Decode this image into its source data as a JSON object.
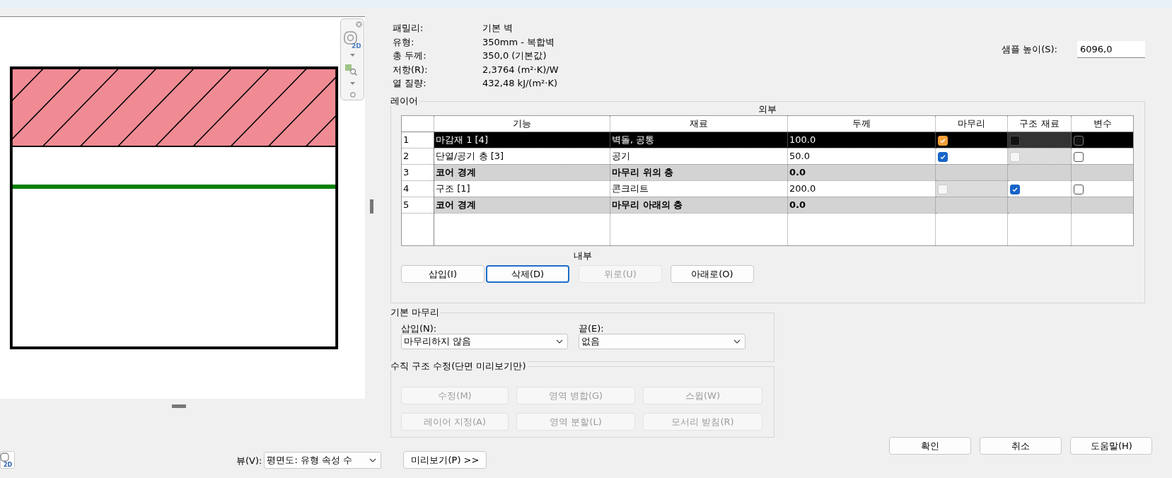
{
  "info": [
    {
      "label": "패밀리:",
      "value": "기본 벽"
    },
    {
      "label": "유형:",
      "value": "350mm - 복합벽"
    },
    {
      "label": "총 두께:",
      "value": "350,0 (기본값)"
    },
    {
      "label": "저항(R):",
      "value": "2,3764 (m²·K)/W"
    },
    {
      "label": "열 질량:",
      "value": "432,48 kJ/(m²·K)"
    }
  ],
  "sample_height": {
    "label": "샘플 높이(S):",
    "value": "6096,0"
  },
  "layers": {
    "title": "레이어",
    "exterior_label": "외부",
    "interior_label": "내부",
    "columns": [
      "기능",
      "재료",
      "두께",
      "마무리",
      "구조 재료",
      "변수"
    ],
    "rows": [
      {
        "number": "1",
        "selected": true,
        "kind": "layer",
        "function": "마감재 1 [4]",
        "material": "벽돌, 공통",
        "thickness": "100.0",
        "finish": {
          "checked": true,
          "disabled": false
        },
        "structural": {
          "checked": false,
          "disabled": true
        },
        "variable": {
          "checked": false,
          "disabled": false
        }
      },
      {
        "number": "2",
        "selected": false,
        "kind": "layer",
        "function": "단열/공기 층 [3]",
        "material": "공기",
        "thickness": "50.0",
        "finish": {
          "checked": true,
          "disabled": false
        },
        "structural": {
          "checked": false,
          "disabled": true
        },
        "variable": {
          "checked": false,
          "disabled": false
        }
      },
      {
        "number": "3",
        "selected": false,
        "kind": "core_boundary",
        "function": "코어 경계",
        "material": "마무리 위의 층",
        "thickness": "0.0"
      },
      {
        "number": "4",
        "selected": false,
        "kind": "layer",
        "function": "구조 [1]",
        "material": "콘크리트",
        "thickness": "200.0",
        "finish": {
          "checked": false,
          "disabled": true
        },
        "structural": {
          "checked": true,
          "disabled": false
        },
        "variable": {
          "checked": false,
          "disabled": false
        }
      },
      {
        "number": "5",
        "selected": false,
        "kind": "core_boundary",
        "function": "코어 경계",
        "material": "마무리 아래의 층",
        "thickness": "0.0"
      }
    ],
    "buttons": [
      {
        "label": "삽입(I)",
        "disabled": false,
        "focused": false
      },
      {
        "label": "삭제(D)",
        "disabled": false,
        "focused": true
      },
      {
        "label": "위로(U)",
        "disabled": true,
        "focused": false
      },
      {
        "label": "아래로(O)",
        "disabled": false,
        "focused": false
      }
    ]
  },
  "default_wrapping": {
    "title": "기본 마무리",
    "fields": [
      {
        "label": "삽입(N):",
        "value": "마무리하지 않음"
      },
      {
        "label": "끝(E):",
        "value": "없음"
      }
    ]
  },
  "vertical_structure": {
    "title": "수직 구조 수정(단면 미리보기만)",
    "buttons": [
      {
        "label": "수정(M)",
        "disabled": true
      },
      {
        "label": "영역 병합(G)",
        "disabled": true
      },
      {
        "label": "스윕(W)",
        "disabled": true
      },
      {
        "label": "레이어 지정(A)",
        "disabled": true
      },
      {
        "label": "영역 분할(L)",
        "disabled": true
      },
      {
        "label": "모서리 받침(R)",
        "disabled": true
      }
    ]
  },
  "view": {
    "label": "뷰(V):",
    "value": "평면도: 유형 속성 수"
  },
  "preview_button": "미리보기(P) >>",
  "nav_icon_text": "2D",
  "view_icon_text": "2D",
  "dialog_buttons": [
    "확인",
    "취소",
    "도움말(H)"
  ]
}
